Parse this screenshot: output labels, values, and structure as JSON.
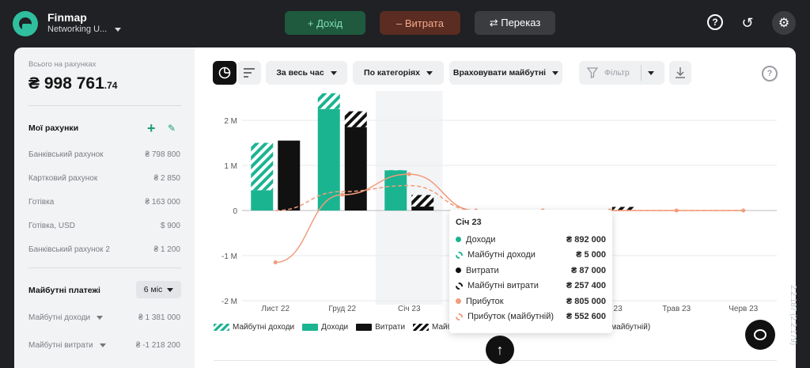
{
  "app": {
    "brand": "Finmap",
    "workspace": "Networking U...",
    "version": "2.2.187 (2.2.179)"
  },
  "topbar": {
    "income_label": "+ Дохід",
    "expense_label": "– Витрата",
    "transfer_label": "⇄ Переказ"
  },
  "sidebar": {
    "total_label": "Всього на рахунках",
    "total_value": "₴ 998 761",
    "total_cents": ".74",
    "accounts_title": "Мої рахунки",
    "accounts": [
      {
        "name": "Банківський рахунок",
        "value": "₴ 798 800"
      },
      {
        "name": "Картковий рахунок",
        "value": "₴ 2 850"
      },
      {
        "name": "Готівка",
        "value": "₴ 163 000"
      },
      {
        "name": "Готівка, USD",
        "value": "$ 900"
      },
      {
        "name": "Банківський рахунок 2",
        "value": "₴ 1 200"
      }
    ],
    "future_title": "Майбутні платежі",
    "future_period": "6 міс",
    "future_rows": [
      {
        "name": "Майбутні доходи",
        "value": "₴ 1 381 000"
      },
      {
        "name": "Майбутні витрати",
        "value": "₴ -1 218 200"
      }
    ]
  },
  "toolbar": {
    "period": "За весь час",
    "grouping": "По категоріях",
    "future": "Враховувати майбутні",
    "filter": "Фільтр"
  },
  "chart_data": {
    "type": "bar",
    "categories": [
      "Лист 22",
      "Груд 22",
      "Січ 23",
      "Лют 23",
      "Бер 23",
      "Квіт 23",
      "Трав 23",
      "Черв 23"
    ],
    "y_ticks": [
      "2 M",
      "1 M",
      "0",
      "-1 M",
      "-2 M"
    ],
    "ylim": [
      -2000000,
      2300000
    ],
    "highlight_category": "Січ 23",
    "series": [
      {
        "name": "Майбутні доходи",
        "values": [
          1050000,
          350000,
          5000,
          0,
          0,
          0,
          0,
          0
        ],
        "color": "#1bb491",
        "style": "hatch"
      },
      {
        "name": "Доходи",
        "values": [
          450000,
          2250000,
          892000,
          0,
          0,
          0,
          0,
          0
        ],
        "color": "#1bb491",
        "style": "solid"
      },
      {
        "name": "Витрати",
        "values": [
          1550000,
          1850000,
          87000,
          0,
          0,
          0,
          0,
          0
        ],
        "color": "#111111",
        "style": "solid"
      },
      {
        "name": "Майбутні витрати",
        "values": [
          0,
          350000,
          257400,
          0,
          0,
          80000,
          0,
          0
        ],
        "color": "#111111",
        "style": "hatch"
      },
      {
        "name": "Прибуток",
        "values": [
          -1150000,
          350000,
          805000,
          0,
          0,
          0,
          0,
          0
        ],
        "color": "#f29c7b",
        "style": "line"
      },
      {
        "name": "Прибуток (майбутній)",
        "values": [
          0,
          420000,
          552600,
          0,
          0,
          0,
          0,
          0
        ],
        "color": "#f29c7b",
        "style": "dashed"
      }
    ]
  },
  "legend": [
    {
      "label": "Майбутні доходи",
      "swatch": "sw-hatch-g"
    },
    {
      "label": "Доходи",
      "swatch": "sw-g"
    },
    {
      "label": "Витрати",
      "swatch": "sw-k"
    },
    {
      "label": "Майбутні витрати",
      "swatch": "sw-hatch-k"
    },
    {
      "label": "Прибуток",
      "swatch": "sw-line"
    },
    {
      "label": "Прибуток (майбутній)",
      "swatch": "sw-dline"
    }
  ],
  "tooltip": {
    "title": "Січ 23",
    "rows": [
      {
        "label": "Доходи",
        "value": "₴ 892 000",
        "color": "#1bb491",
        "kind": "dot"
      },
      {
        "label": "Майбутні доходи",
        "value": "₴ 5 000",
        "color": "#1bb491",
        "kind": "ring"
      },
      {
        "label": "Витрати",
        "value": "₴ 87 000",
        "color": "#111111",
        "kind": "dot"
      },
      {
        "label": "Майбутні витрати",
        "value": "₴ 257 400",
        "color": "#111111",
        "kind": "ring"
      },
      {
        "label": "Прибуток",
        "value": "₴ 805 000",
        "color": "#f29c7b",
        "kind": "dot"
      },
      {
        "label": "Прибуток (майбутній)",
        "value": "₴ 552 600",
        "color": "#f29c7b",
        "kind": "ring"
      }
    ]
  }
}
